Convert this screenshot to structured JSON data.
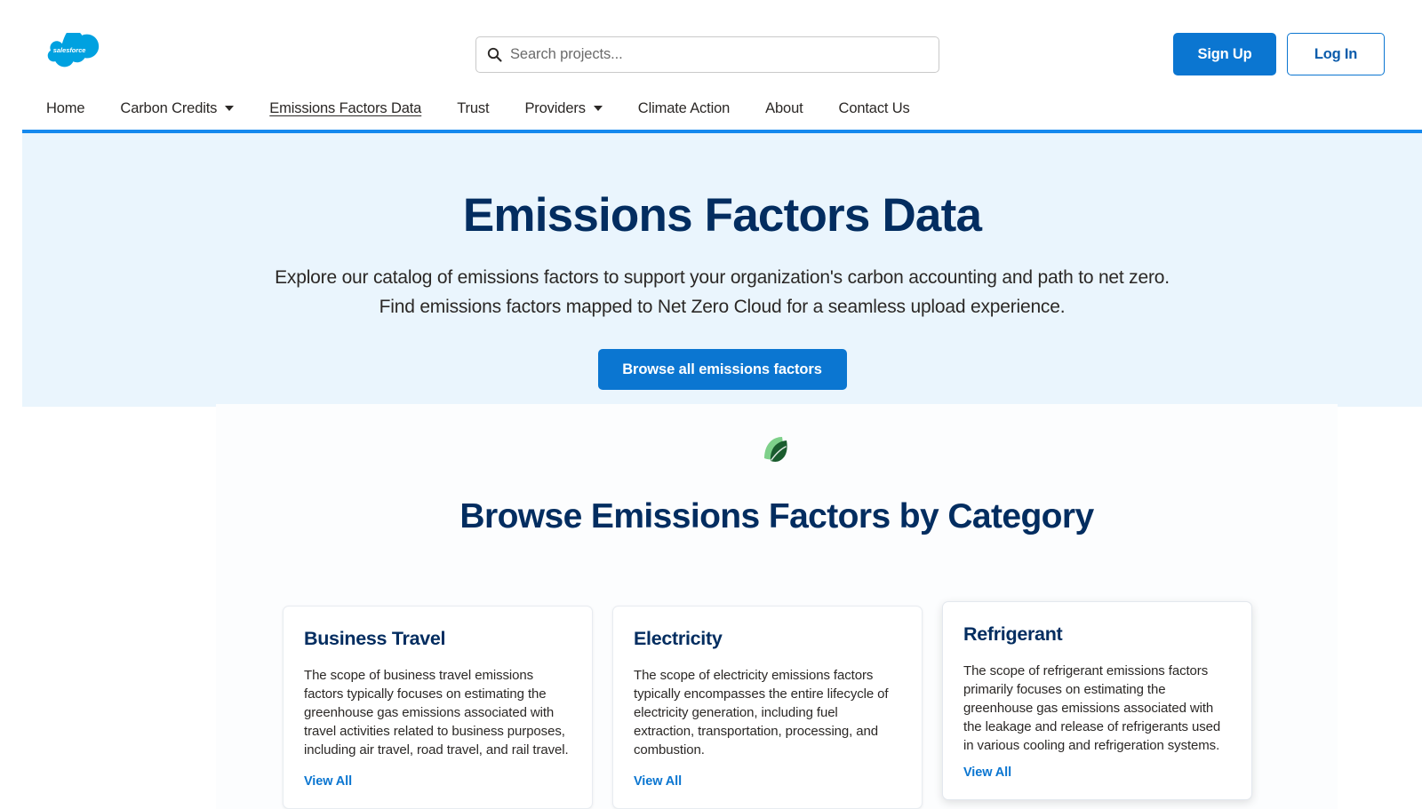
{
  "brand": {
    "logo_text": "salesforce",
    "logo_color": "#00A1E0",
    "accent": "#0b76d1",
    "navy": "#032d60"
  },
  "search": {
    "placeholder": "Search projects...",
    "value": "",
    "icon": "search-icon"
  },
  "auth": {
    "sign_up": "Sign Up",
    "log_in": "Log In"
  },
  "nav": {
    "items": [
      {
        "label": "Home",
        "has_caret": false,
        "active": false
      },
      {
        "label": "Carbon Credits",
        "has_caret": true,
        "active": false
      },
      {
        "label": "Emissions Factors Data",
        "has_caret": false,
        "active": true
      },
      {
        "label": "Trust",
        "has_caret": false,
        "active": false
      },
      {
        "label": "Providers",
        "has_caret": true,
        "active": false
      },
      {
        "label": "Climate Action",
        "has_caret": false,
        "active": false
      },
      {
        "label": "About",
        "has_caret": false,
        "active": false
      },
      {
        "label": "Contact Us",
        "has_caret": false,
        "active": false
      }
    ]
  },
  "hero": {
    "title": "Emissions Factors Data",
    "subtitle": "Explore our catalog of emissions factors to support your organization's carbon accounting and path to net zero. Find emissions factors mapped to Net Zero Cloud for a seamless upload experience.",
    "cta_label": "Browse all emissions factors",
    "background": "#eaf5fd",
    "top_rule_color": "#1589ee"
  },
  "section": {
    "icon": "leaf-icon",
    "icon_colors": {
      "light": "#7ed08a",
      "dark": "#1a5c2e"
    },
    "title": "Browse Emissions Factors by Category",
    "cards": [
      {
        "title": "Business Travel",
        "description": "The scope of business travel emissions factors typically focuses on estimating the greenhouse gas emissions associated with travel activities related to business purposes, including air travel, road travel, and rail travel.",
        "link_label": "View All",
        "raised": false
      },
      {
        "title": "Electricity",
        "description": "The scope of electricity emissions factors typically encompasses the entire lifecycle of electricity generation, including fuel extraction, transportation, processing, and combustion.",
        "link_label": "View All",
        "raised": false
      },
      {
        "title": "Refrigerant",
        "description": "The scope of refrigerant emissions factors primarily focuses on estimating the greenhouse gas emissions associated with the leakage and release of refrigerants used in various cooling and refrigeration systems.",
        "link_label": "View All",
        "raised": true
      }
    ]
  }
}
